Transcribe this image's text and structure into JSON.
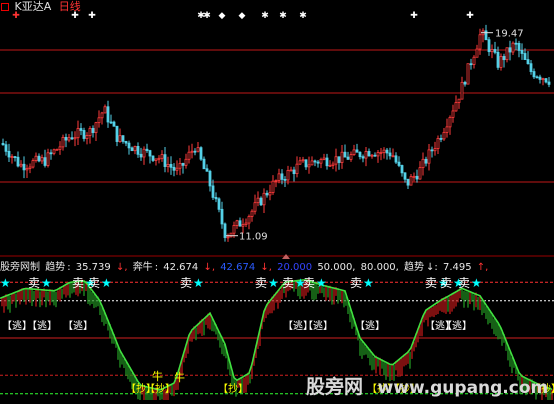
{
  "header": {
    "stock_name": "K亚达A",
    "period": "日线",
    "colors": {
      "name": "#e0e0e0",
      "period": "#ff3333"
    }
  },
  "chart_data": [
    {
      "type": "candlestick",
      "title": "日线",
      "annotations": [
        {
          "text": "19.47",
          "kind": "high",
          "value": 19.47
        },
        {
          "text": "11.09",
          "kind": "low",
          "value": 11.09
        }
      ],
      "ylim": [
        10.5,
        20.2
      ],
      "colors": {
        "up": "#ff3b3b",
        "down": "#54d1e8",
        "guide": "#c01818"
      }
    },
    {
      "type": "line",
      "title": "股旁网制",
      "series": [
        {
          "name": "趋势",
          "value": 35.739
        },
        {
          "name": "奔牛",
          "value": 42.674
        },
        {
          "value": 42.674
        },
        {
          "value": 20.0
        },
        {
          "value": 50.0
        },
        {
          "value": 80.0
        },
        {
          "name": "趋势",
          "value": 7.495
        }
      ],
      "ylim": [
        0,
        100
      ],
      "colors": {
        "bull": "#ff3030",
        "bear": "#40e040",
        "signal": "#00ffff",
        "bottom": "#ffff00"
      }
    }
  ],
  "indicator_header": {
    "name": "股旁网制",
    "label1": "趋势",
    "value1": "35.739",
    "label2": "奔牛",
    "value2": "42.674",
    "value3": "42.674",
    "value4": "20.000",
    "value5": "50.000,",
    "value6": "80.000,",
    "label3": "趋势",
    "value7": "7.495"
  },
  "signals": {
    "sell_text": "卖",
    "escape_text": "【逃】",
    "copy_text": "【抄】",
    "buy_bottom_text": "【抄】",
    "bull_text": "牛"
  },
  "watermark": {
    "text1": "股旁网",
    "text2": "www.gupang.com"
  }
}
